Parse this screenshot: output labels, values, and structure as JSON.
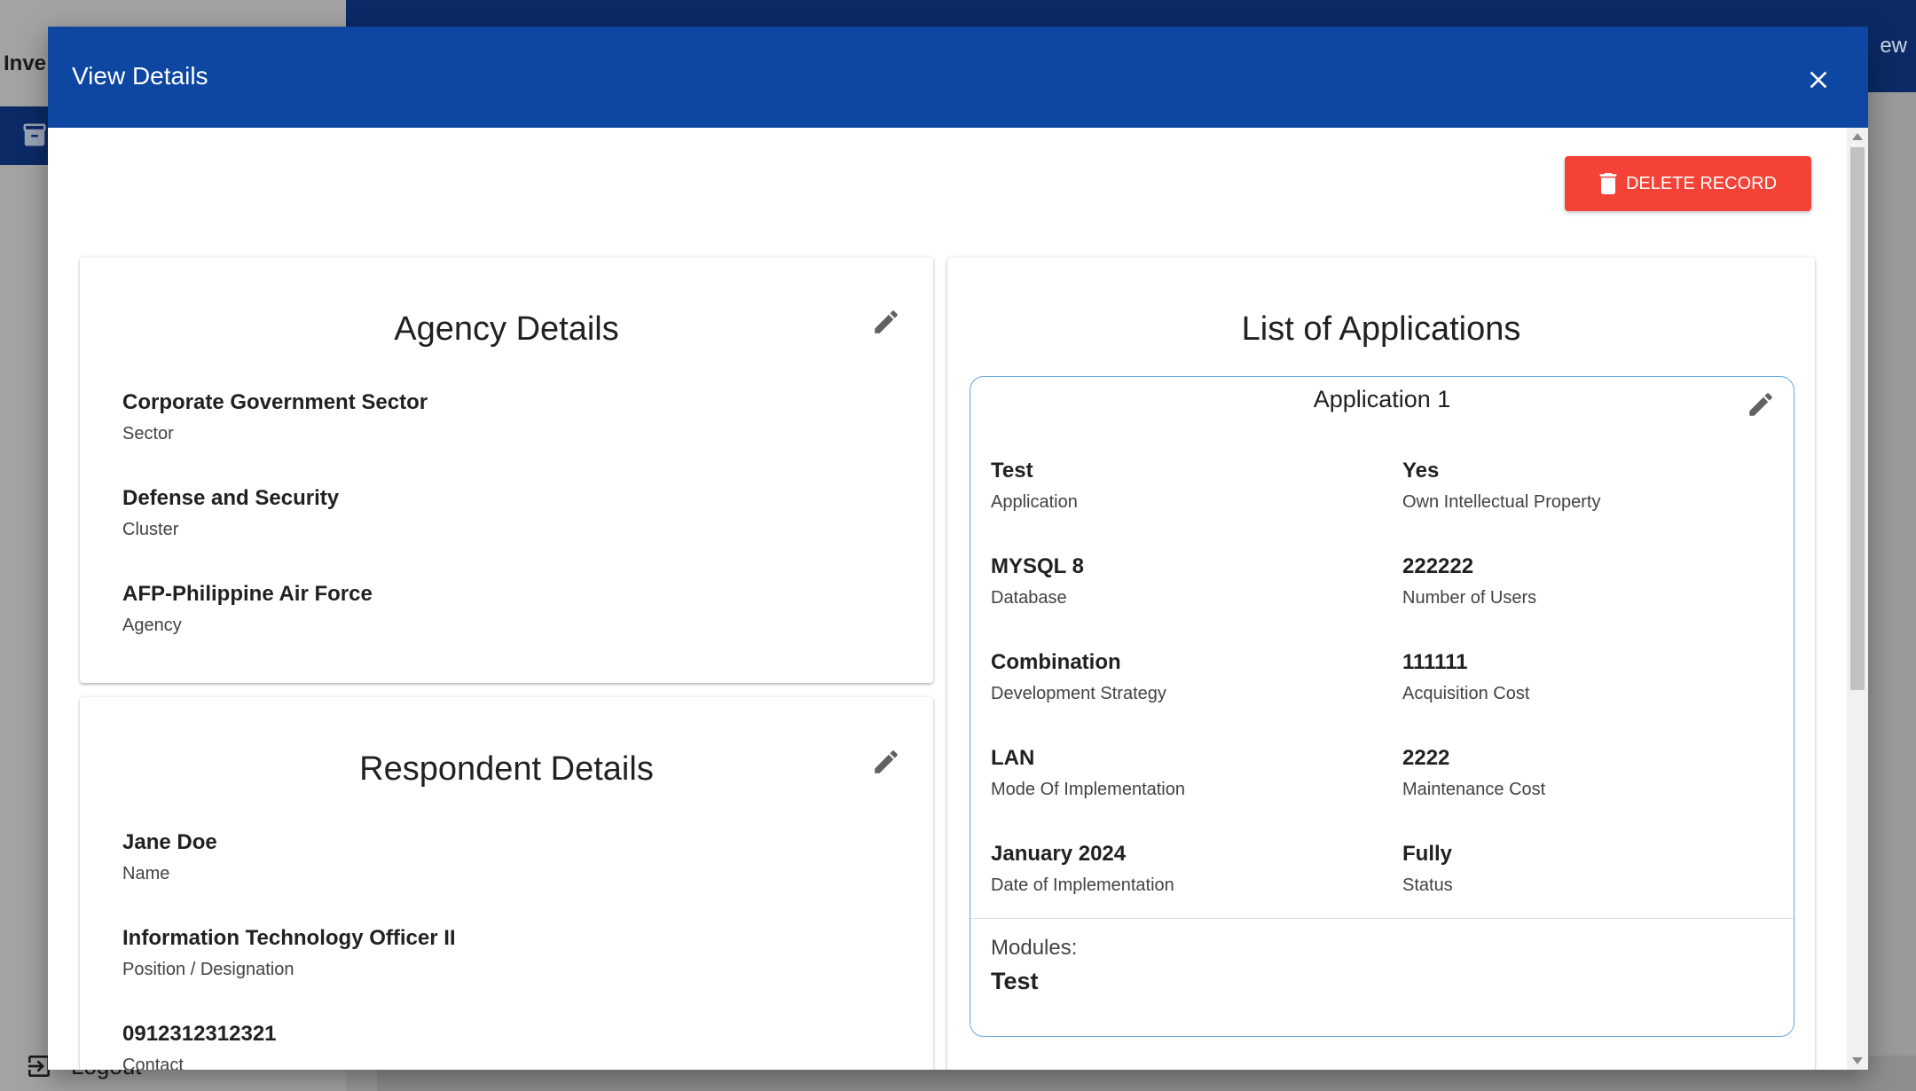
{
  "background": {
    "app_title": "Inve",
    "view_text": "ew",
    "logout": "Logout"
  },
  "dialog": {
    "title": "View Details",
    "delete_label": "DELETE RECORD"
  },
  "agency": {
    "title": "Agency Details",
    "fields": [
      {
        "value": "Corporate Government Sector",
        "label": "Sector"
      },
      {
        "value": "Defense and Security",
        "label": "Cluster"
      },
      {
        "value": "AFP-Philippine Air Force",
        "label": "Agency"
      }
    ]
  },
  "respondent": {
    "title": "Respondent Details",
    "fields": [
      {
        "value": "Jane Doe",
        "label": "Name"
      },
      {
        "value": "Information Technology Officer II",
        "label": "Position / Designation"
      },
      {
        "value": "0912312312321",
        "label": "Contact"
      }
    ]
  },
  "applications": {
    "title": "List of Applications",
    "items": [
      {
        "title": "Application 1",
        "left": [
          {
            "value": "Test",
            "label": "Application"
          },
          {
            "value": "MYSQL 8",
            "label": "Database"
          },
          {
            "value": "Combination",
            "label": "Development Strategy"
          },
          {
            "value": "LAN",
            "label": "Mode Of Implementation"
          },
          {
            "value": "January 2024",
            "label": "Date of Implementation"
          }
        ],
        "right": [
          {
            "value": "Yes",
            "label": "Own Intellectual Property"
          },
          {
            "value": "222222",
            "label": "Number of Users"
          },
          {
            "value": "111111",
            "label": "Acquisition Cost"
          },
          {
            "value": "2222",
            "label": "Maintenance Cost"
          },
          {
            "value": "Fully",
            "label": "Status"
          }
        ],
        "modules_label": "Modules:",
        "modules_value": "Test"
      }
    ]
  },
  "colors": {
    "header": "#0d47a1",
    "delete": "#f44336",
    "app_border": "#64a8e0"
  },
  "icons": {
    "close": "close-icon",
    "edit": "pencil-icon",
    "delete": "trash-icon",
    "logout": "logout-icon",
    "nav": "archive-icon"
  }
}
